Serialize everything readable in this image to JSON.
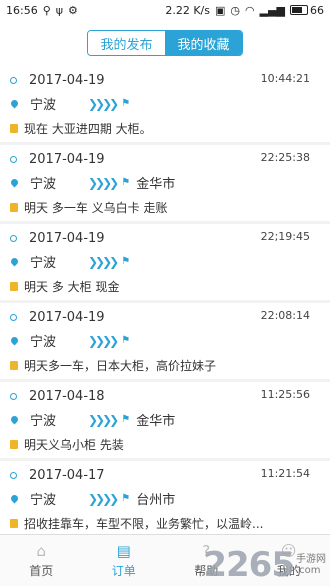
{
  "status_bar": {
    "time": "16:56",
    "speed": "2.22 K/s",
    "battery": "66"
  },
  "segmented": {
    "tab1": "我的发布",
    "tab2": "我的收藏",
    "active": "tab2"
  },
  "orders": [
    {
      "date": "2017-04-19",
      "time": "10:44:21",
      "from": "宁波",
      "to": "",
      "desc": "现在 大亚进四期 大柜。"
    },
    {
      "date": "2017-04-19",
      "time": "22:25:38",
      "from": "宁波",
      "to": "金华市",
      "desc": "明天 多一车 义乌白卡 走账"
    },
    {
      "date": "2017-04-19",
      "time": "22;19:45",
      "from": "宁波",
      "to": "",
      "desc": "明天 多 大柜 现金"
    },
    {
      "date": "2017-04-19",
      "time": "22:08:14",
      "from": "宁波",
      "to": "",
      "desc": "明天多一车，日本大柜，高价拉妹子"
    },
    {
      "date": "2017-04-18",
      "time": "11:25:56",
      "from": "宁波",
      "to": "金华市",
      "desc": "明天义乌小柜 先装"
    },
    {
      "date": "2017-04-17",
      "time": "11:21:54",
      "from": "宁波",
      "to": "台州市",
      "desc": "招收挂靠车，车型不限，业务繁忙，以温岭..."
    }
  ],
  "tabbar": {
    "home": "首页",
    "orders": "订单",
    "help": "帮助",
    "mine": "我的"
  },
  "watermark": {
    "number": "2265",
    "line1": "手游网",
    "line2": ".com"
  },
  "colors": {
    "accent": "#2ba3d6",
    "note_icon": "#f0b429"
  }
}
